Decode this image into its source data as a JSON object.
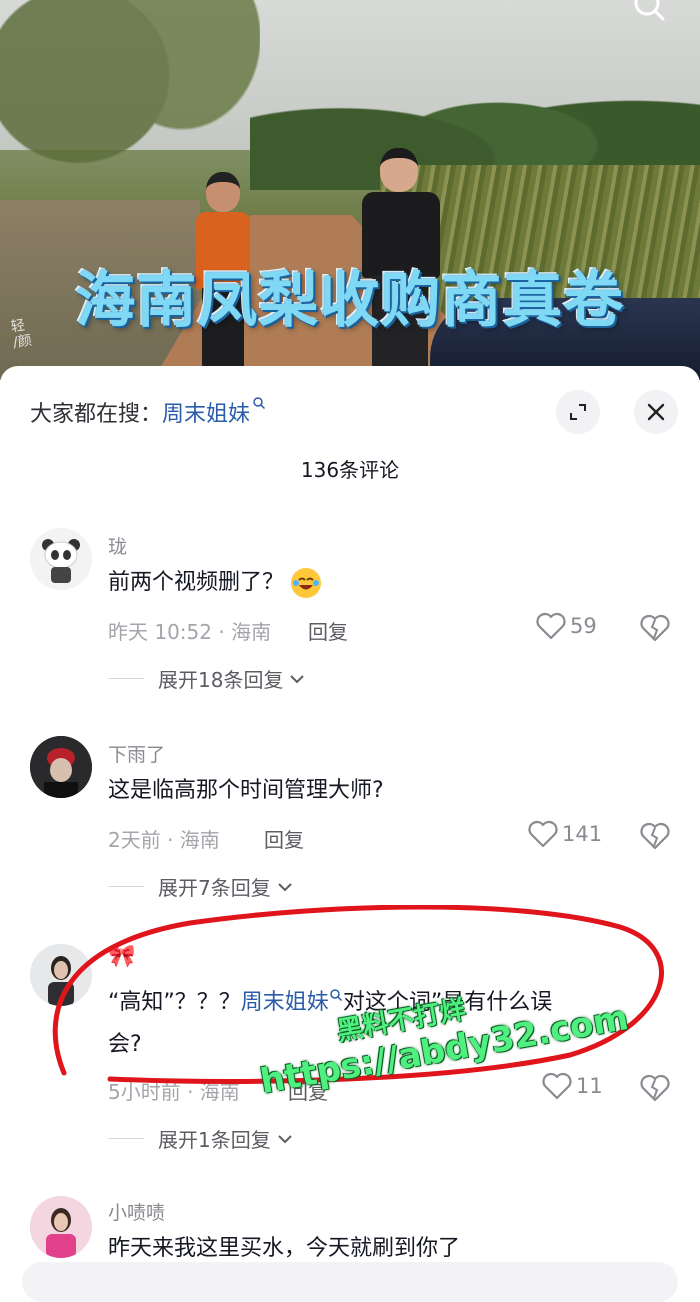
{
  "video": {
    "title": "海南凤梨收购商真卷",
    "small_watermark": "轻\n/颜"
  },
  "sheet": {
    "suggest_prefix": "大家都在搜：",
    "suggest_link": "周末姐妹",
    "comment_count": "136条评论"
  },
  "comments": [
    {
      "nickname": "珑",
      "text": "前两个视频删了？",
      "has_emoji": true,
      "meta": "昨天 10:52 · 海南",
      "reply": "回复",
      "likes": "59",
      "expand": "展开18条回复"
    },
    {
      "nickname": "下雨了",
      "text": "这是临高那个时间管理大师?",
      "meta": "2天前 · 海南",
      "reply": "回复",
      "likes": "141",
      "expand": "展开7条回复"
    },
    {
      "nickname": "🎀",
      "text_before": "“高知”？？？",
      "text_link": "周末姐妹",
      "text_after": "对这个词”是有什么误",
      "text_line2": "会?",
      "meta": "5小时前 · 海南",
      "reply": "回复",
      "likes": "11",
      "expand": "展开1条回复"
    },
    {
      "nickname": "小啧啧",
      "text": "昨天来我这里买水，今天就刷到你了"
    }
  ],
  "overlay_watermark": {
    "line1": "黑料不打烊",
    "line2": "https://abdy32.com"
  },
  "colors": {
    "link": "#2a5caa",
    "annotation_circle": "#e0141b",
    "watermark": "#4ff080"
  }
}
